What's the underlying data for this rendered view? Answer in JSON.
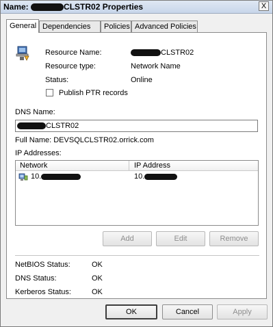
{
  "window": {
    "title_prefix": "Name:",
    "title_suffix": "CLSTR02 Properties",
    "close_label": "X"
  },
  "tabs": [
    {
      "label": "General",
      "active": true
    },
    {
      "label": "Dependencies",
      "active": false
    },
    {
      "label": "Policies",
      "active": false
    },
    {
      "label": "Advanced Policies",
      "active": false
    }
  ],
  "general": {
    "resource_name_label": "Resource Name:",
    "resource_name_suffix": "CLSTR02",
    "resource_type_label": "Resource type:",
    "resource_type_value": "Network Name",
    "status_label": "Status:",
    "status_value": "Online",
    "publish_ptr_label": "Publish PTR records",
    "publish_ptr_checked": false,
    "dns_name_label": "DNS Name:",
    "dns_name_suffix": "CLSTR02",
    "full_name_text": "Full Name: DEVSQLCLSTR02.orrick.com",
    "ip_addresses_label": "IP Addresses:",
    "ip_columns": [
      "Network",
      "IP Address"
    ],
    "ip_rows": [
      {
        "network_prefix": "10.",
        "ip_prefix": "10."
      }
    ],
    "buttons": {
      "add": "Add",
      "edit": "Edit",
      "remove": "Remove"
    },
    "netbios_status_label": "NetBIOS Status:",
    "netbios_status_value": "OK",
    "dns_status_label": "DNS Status:",
    "dns_status_value": "OK",
    "kerberos_status_label": "Kerberos Status:",
    "kerberos_status_value": "OK"
  },
  "footer": {
    "ok": "OK",
    "cancel": "Cancel",
    "apply": "Apply"
  },
  "icons": {
    "resource_icon": "network-name-resource-icon",
    "row_icon": "network-adapter-icon"
  },
  "colors": {
    "window_bg": "#f0f0f0",
    "panel_bg": "#ffffff",
    "disabled_text": "#8d8d8d",
    "redaction": "#111111"
  }
}
